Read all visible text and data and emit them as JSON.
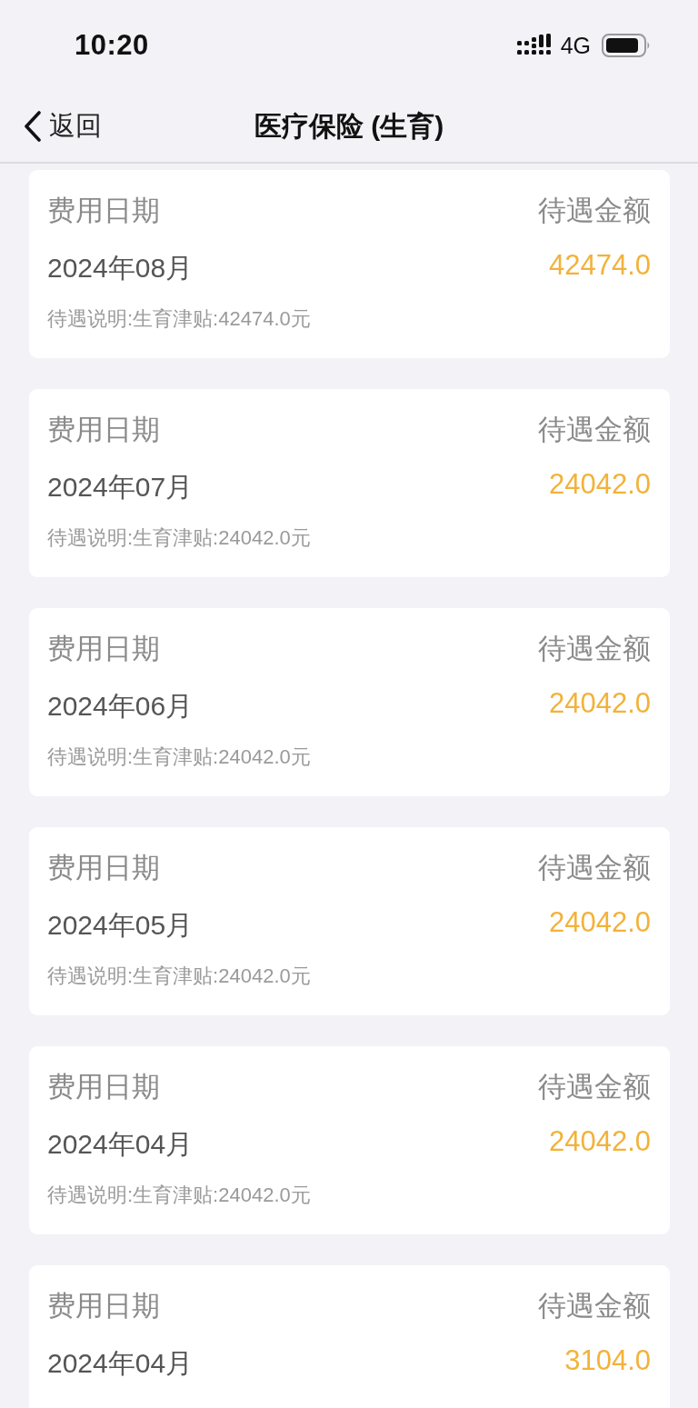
{
  "status_bar": {
    "time": "10:20",
    "network": "4G"
  },
  "nav_bar": {
    "back_label": "返回",
    "title": "医疗保险 (生育)"
  },
  "records": [
    {
      "date_label": "费用日期",
      "amount_label": "待遇金额",
      "date": "2024年08月",
      "amount": "42474.0",
      "description": "待遇说明:生育津贴:42474.0元"
    },
    {
      "date_label": "费用日期",
      "amount_label": "待遇金额",
      "date": "2024年07月",
      "amount": "24042.0",
      "description": "待遇说明:生育津贴:24042.0元"
    },
    {
      "date_label": "费用日期",
      "amount_label": "待遇金额",
      "date": "2024年06月",
      "amount": "24042.0",
      "description": "待遇说明:生育津贴:24042.0元"
    },
    {
      "date_label": "费用日期",
      "amount_label": "待遇金额",
      "date": "2024年05月",
      "amount": "24042.0",
      "description": "待遇说明:生育津贴:24042.0元"
    },
    {
      "date_label": "费用日期",
      "amount_label": "待遇金额",
      "date": "2024年04月",
      "amount": "24042.0",
      "description": "待遇说明:生育津贴:24042.0元"
    },
    {
      "date_label": "费用日期",
      "amount_label": "待遇金额",
      "date": "2024年04月",
      "amount": "3104.0"
    }
  ]
}
